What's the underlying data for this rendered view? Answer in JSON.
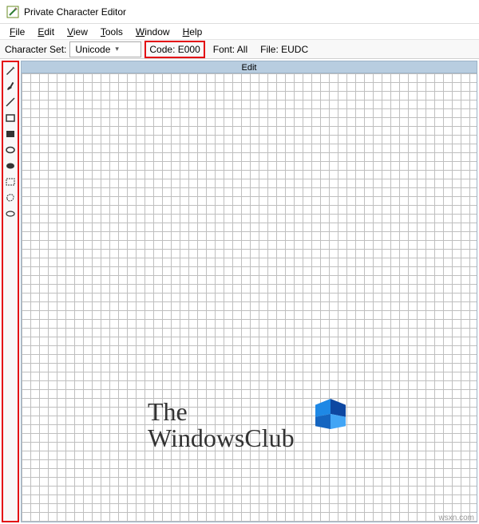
{
  "titlebar": {
    "title": "Private Character Editor"
  },
  "menubar": {
    "items": [
      {
        "label": "File",
        "key": "F"
      },
      {
        "label": "Edit",
        "key": "E"
      },
      {
        "label": "View",
        "key": "V"
      },
      {
        "label": "Tools",
        "key": "T"
      },
      {
        "label": "Window",
        "key": "W"
      },
      {
        "label": "Help",
        "key": "H"
      }
    ]
  },
  "inforow": {
    "charset_label": "Character Set:",
    "charset_value": "Unicode",
    "code_label": "Code: E000",
    "font_label": "Font: All",
    "file_label": "File: EUDC"
  },
  "tools": [
    {
      "name": "pencil-icon"
    },
    {
      "name": "brush-icon"
    },
    {
      "name": "line-icon"
    },
    {
      "name": "rectangle-outline-icon"
    },
    {
      "name": "rectangle-filled-icon"
    },
    {
      "name": "ellipse-outline-icon"
    },
    {
      "name": "ellipse-filled-icon"
    },
    {
      "name": "rect-select-icon"
    },
    {
      "name": "freeform-select-icon"
    },
    {
      "name": "eraser-icon"
    }
  ],
  "canvas": {
    "header": "Edit"
  },
  "watermark": {
    "line1": "The",
    "line2": "WindowsClub"
  },
  "credit": "wsxn.com"
}
